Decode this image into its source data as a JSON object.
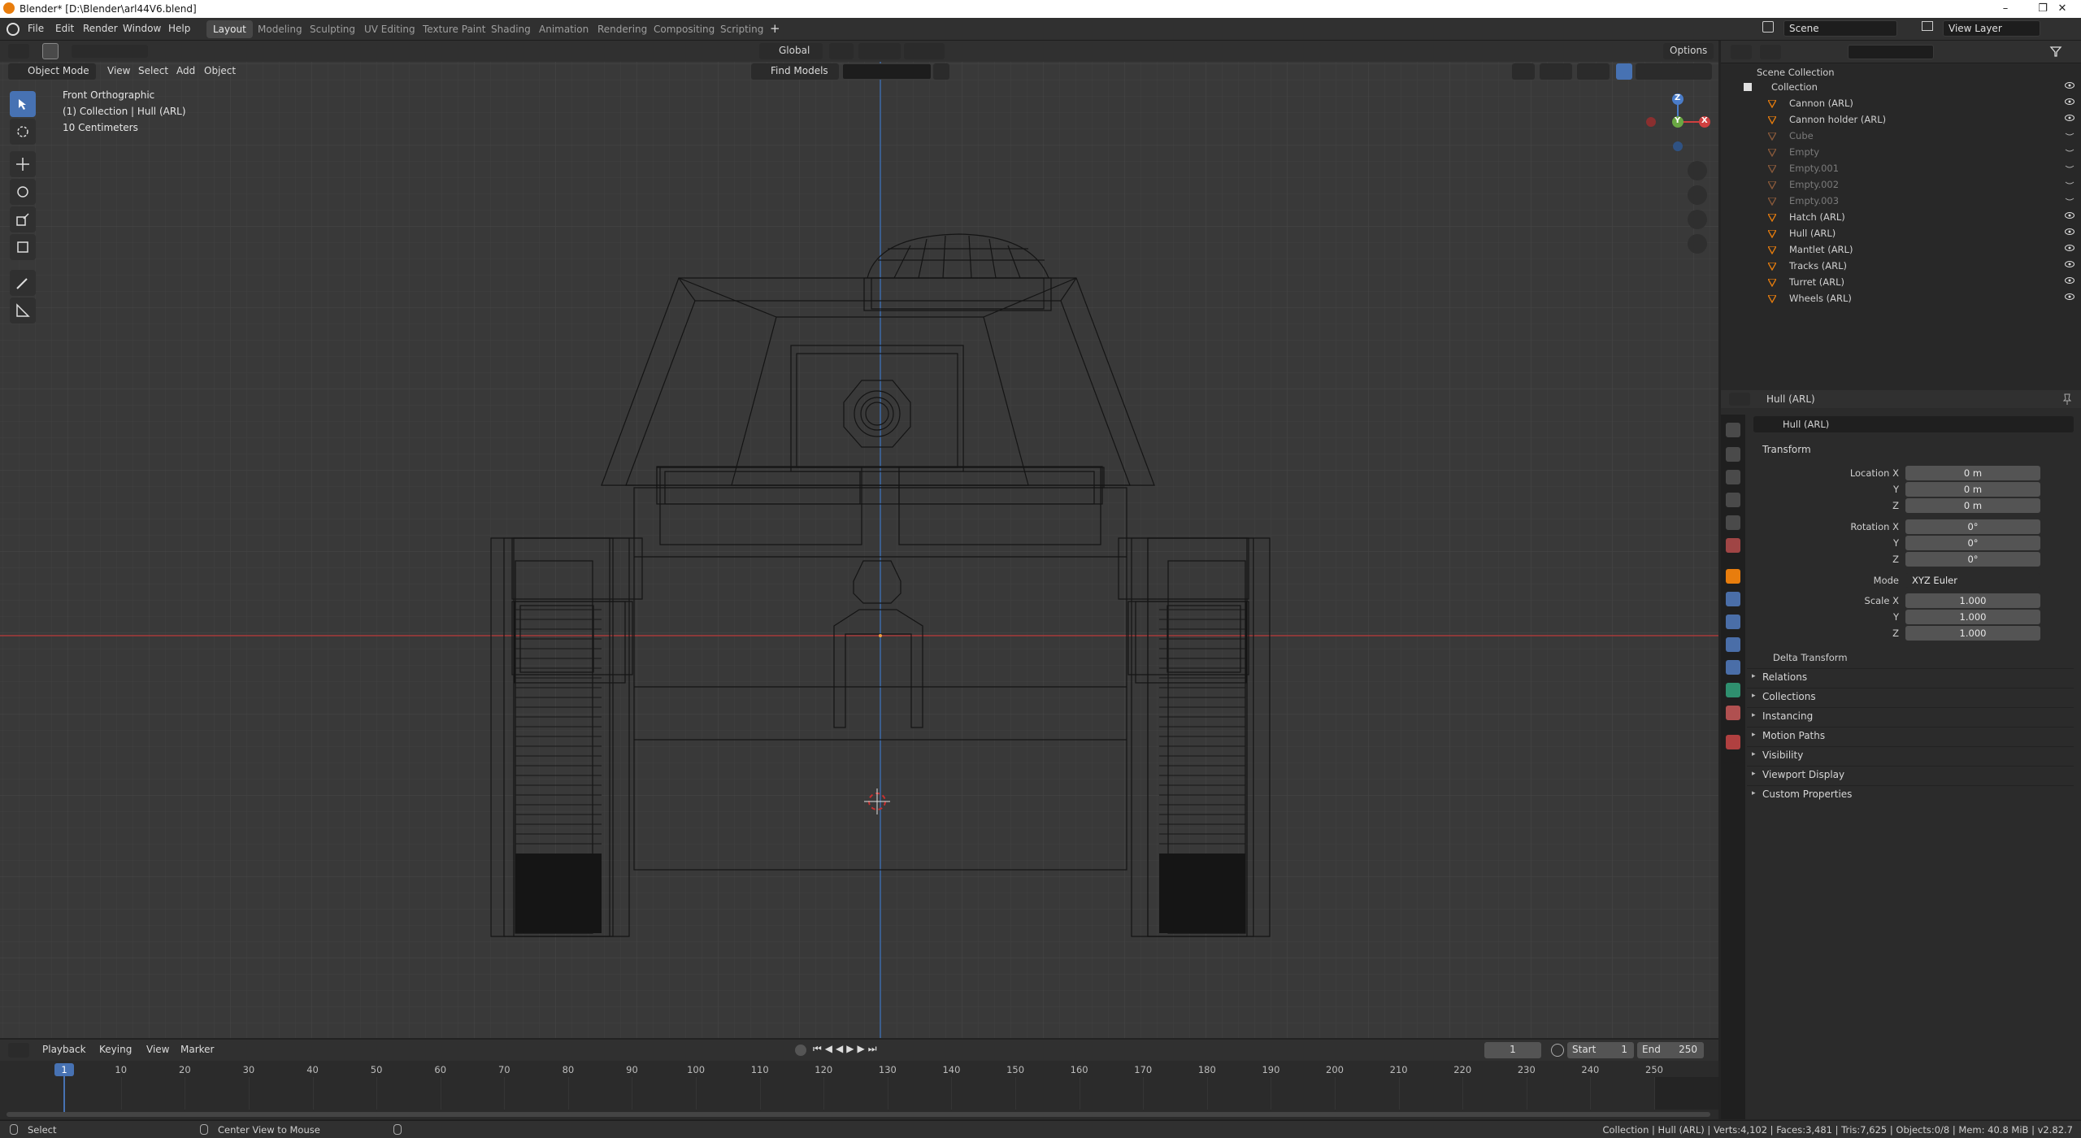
{
  "window": {
    "title": "Blender* [D:\\Blender\\arl44V6.blend]",
    "minimize": "–",
    "maximize": "❐",
    "close": "✕"
  },
  "menu": [
    "File",
    "Edit",
    "Render",
    "Window",
    "Help"
  ],
  "workspaces": [
    "Layout",
    "Modeling",
    "Sculpting",
    "UV Editing",
    "Texture Paint",
    "Shading",
    "Animation",
    "Rendering",
    "Compositing",
    "Scripting"
  ],
  "workspace_add": "+",
  "scene": {
    "name": "Scene",
    "view_layer": "View Layer"
  },
  "toolheader": {
    "orientation": "Global",
    "options": "Options"
  },
  "viewport_header": {
    "mode": "Object Mode",
    "view": "View",
    "select": "Select",
    "add": "Add",
    "object": "Object",
    "find": "Find Models",
    "search_placeholder": ""
  },
  "viewport_overlay": {
    "view_name": "Front Orthographic",
    "collection": "(1) Collection | Hull (ARL)",
    "scale": "10 Centimeters"
  },
  "gizmo": {
    "z": "Z",
    "y": "Y",
    "x": "X"
  },
  "outliner": {
    "root": "Scene Collection",
    "collection": "Collection",
    "items": [
      {
        "name": "Cannon (ARL)",
        "dim": false
      },
      {
        "name": "Cannon holder (ARL)",
        "dim": false
      },
      {
        "name": "Cube",
        "dim": true
      },
      {
        "name": "Empty",
        "dim": true
      },
      {
        "name": "Empty.001",
        "dim": true
      },
      {
        "name": "Empty.002",
        "dim": true
      },
      {
        "name": "Empty.003",
        "dim": true
      },
      {
        "name": "Hatch (ARL)",
        "dim": false
      },
      {
        "name": "Hull (ARL)",
        "dim": false
      },
      {
        "name": "Mantlet (ARL)",
        "dim": false
      },
      {
        "name": "Tracks (ARL)",
        "dim": false
      },
      {
        "name": "Turret (ARL)",
        "dim": false
      },
      {
        "name": "Wheels (ARL)",
        "dim": false
      }
    ]
  },
  "properties": {
    "context": "Hull (ARL)",
    "object_name": "Hull (ARL)",
    "transform_title": "Transform",
    "location_x_label": "Location X",
    "location_x": "0 m",
    "location_y_label": "Y",
    "location_y": "0 m",
    "location_z_label": "Z",
    "location_z": "0 m",
    "rotation_x_label": "Rotation X",
    "rotation_x": "0°",
    "rotation_y_label": "Y",
    "rotation_y": "0°",
    "rotation_z_label": "Z",
    "rotation_z": "0°",
    "mode_label": "Mode",
    "mode": "XYZ Euler",
    "scale_x_label": "Scale X",
    "scale_x": "1.000",
    "scale_y_label": "Y",
    "scale_y": "1.000",
    "scale_z_label": "Z",
    "scale_z": "1.000",
    "delta": "Delta Transform",
    "panels": [
      "Relations",
      "Collections",
      "Instancing",
      "Motion Paths",
      "Visibility",
      "Viewport Display",
      "Custom Properties"
    ]
  },
  "timeline": {
    "playback": "Playback",
    "keying": "Keying",
    "view": "View",
    "marker": "Marker",
    "current_frame": "1",
    "start_label": "Start",
    "start": "1",
    "end_label": "End",
    "end": "250",
    "ticks": [
      "1",
      "10",
      "20",
      "30",
      "40",
      "50",
      "60",
      "70",
      "80",
      "90",
      "100",
      "110",
      "120",
      "130",
      "140",
      "150",
      "160",
      "170",
      "180",
      "190",
      "200",
      "210",
      "220",
      "230",
      "240",
      "250"
    ],
    "playhead": "1"
  },
  "status": {
    "left": "Select",
    "middle": "Center View to Mouse",
    "right": "Collection | Hull (ARL) | Verts:4,102 | Faces:3,481 | Tris:7,625 | Objects:0/8 | Mem: 40.8 MiB | v2.82.7"
  },
  "colors": {
    "accent": "#4772b3",
    "orange": "#e87d0d",
    "x_axis": "#d04040",
    "y_axis": "#6aa843",
    "z_axis": "#4a7cc9",
    "mesh_icon": "#5ad0a8"
  }
}
